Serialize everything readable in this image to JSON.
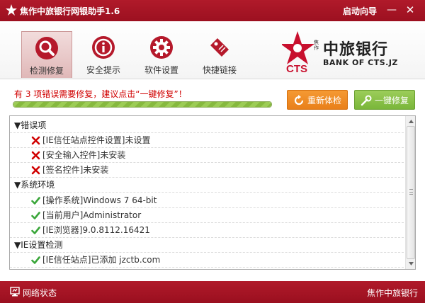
{
  "window": {
    "title": "焦作中旅银行网银助手1.6",
    "guide_label": "启动向导",
    "minimize_glyph": "—",
    "close_glyph": "✕"
  },
  "toolbar": {
    "items": [
      {
        "label": "检测修复",
        "icon": "magnifier-icon",
        "active": true
      },
      {
        "label": "安全提示",
        "icon": "info-icon",
        "active": false
      },
      {
        "label": "软件设置",
        "icon": "gear-icon",
        "active": false
      },
      {
        "label": "快捷链接",
        "icon": "tag-icon",
        "active": false
      }
    ]
  },
  "bank": {
    "logo_text": "CTS",
    "name_cn": "中旅银行",
    "small_cn": "焦作",
    "name_en": "BANK OF CTS.JZ"
  },
  "scan": {
    "message_prefix": "有 ",
    "error_count": "3",
    "message_suffix": " 项错误需要修复，建议点击“一键修复”！",
    "progress": 1.0,
    "recheck_label": "重新体检",
    "fix_label": "一键修复"
  },
  "results": [
    {
      "type": "group",
      "text": "▼错误项"
    },
    {
      "type": "error",
      "text": "[IE信任站点控件设置]未设置"
    },
    {
      "type": "error",
      "text": "[安全输入控件]未安装"
    },
    {
      "type": "error",
      "text": "[签名控件]未安装"
    },
    {
      "type": "group",
      "text": "▼系统环境"
    },
    {
      "type": "ok",
      "text": "[操作系统]Windows 7 64-bit"
    },
    {
      "type": "ok",
      "text": "[当前用户]Administrator"
    },
    {
      "type": "ok",
      "text": "[IE浏览器]9.0.8112.16421"
    },
    {
      "type": "group",
      "text": "▼IE设置检测"
    },
    {
      "type": "ok",
      "text": "[IE信任站点]已添加 jzctb.com"
    }
  ],
  "statusbar": {
    "network_label": "网络状态",
    "brand": "焦作中旅银行"
  },
  "colors": {
    "brand_red": "#a8152a",
    "error_red": "#d00000",
    "ok_green": "#3aa63a",
    "orange_button": "#ef8c22",
    "green_button": "#86bf45"
  }
}
